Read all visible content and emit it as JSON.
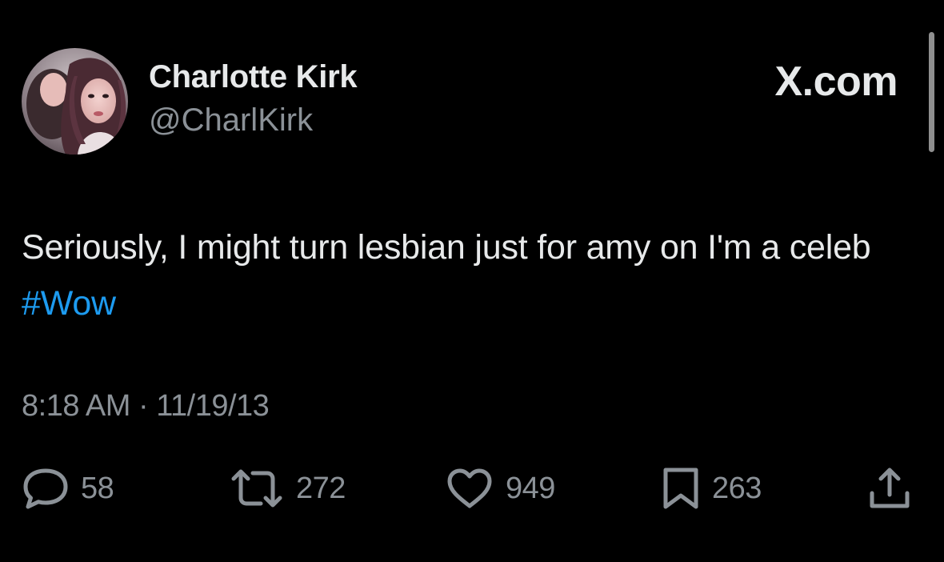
{
  "tweet": {
    "display_name": "Charlotte Kirk",
    "handle": "@CharlKirk",
    "site_logo": "X.com",
    "text_before_hashtag": "Seriously, I might turn lesbian just for amy on I'm a celeb ",
    "hashtag": "#Wow",
    "timestamp": "8:18 AM · 11/19/13"
  },
  "actions": {
    "replies": "58",
    "reposts": "272",
    "likes": "949",
    "bookmarks": "263"
  },
  "icons": [
    "reply-icon",
    "repost-icon",
    "like-icon",
    "bookmark-icon",
    "share-icon"
  ],
  "colors": {
    "background": "#000000",
    "text": "#e7e9ea",
    "secondary_text": "#8b9197",
    "hashtag": "#1d9bf0"
  }
}
